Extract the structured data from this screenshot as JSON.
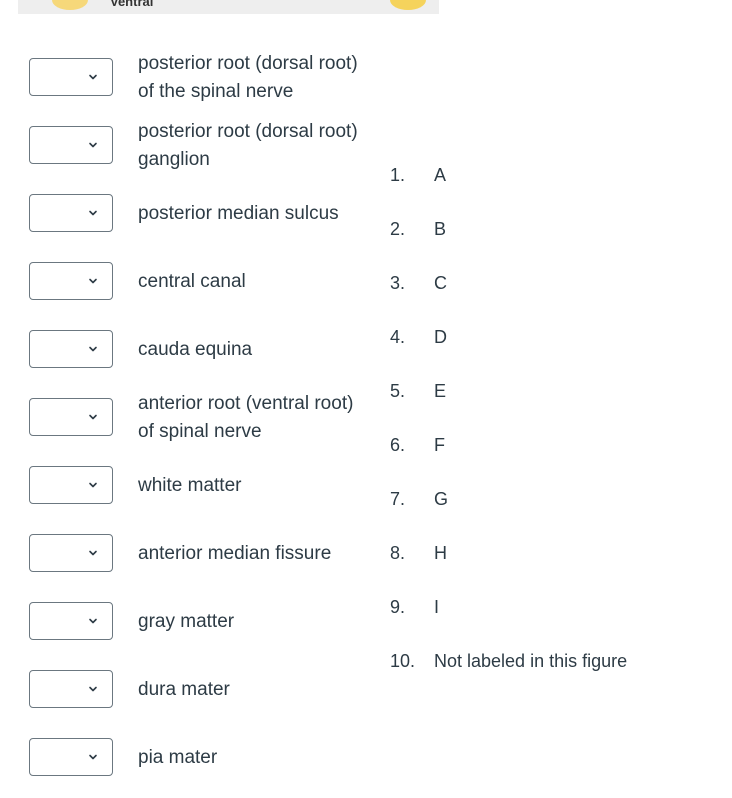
{
  "figure": {
    "caption": "Ventral"
  },
  "rows": [
    {
      "label": "posterior root (dorsal root) of the spinal nerve"
    },
    {
      "label": "posterior root (dorsal root) ganglion"
    },
    {
      "label": "posterior median sulcus"
    },
    {
      "label": "central canal"
    },
    {
      "label": "cauda equina"
    },
    {
      "label": "anterior root (ventral root) of spinal nerve"
    },
    {
      "label": "white matter"
    },
    {
      "label": "anterior median fissure"
    },
    {
      "label": "gray matter"
    },
    {
      "label": "dura mater"
    },
    {
      "label": "pia mater"
    }
  ],
  "options": [
    {
      "num": "1.",
      "text": "A"
    },
    {
      "num": "2.",
      "text": "B"
    },
    {
      "num": "3.",
      "text": "C"
    },
    {
      "num": "4.",
      "text": "D"
    },
    {
      "num": "5.",
      "text": "E"
    },
    {
      "num": "6.",
      "text": "F"
    },
    {
      "num": "7.",
      "text": "G"
    },
    {
      "num": "8.",
      "text": "H"
    },
    {
      "num": "9.",
      "text": "I"
    },
    {
      "num": "10.",
      "text": "Not labeled in this figure"
    }
  ],
  "icons": {
    "dropdown": "chevron-down-icon"
  },
  "colors": {
    "text": "#2d3b45",
    "select_border": "#6b7780"
  }
}
